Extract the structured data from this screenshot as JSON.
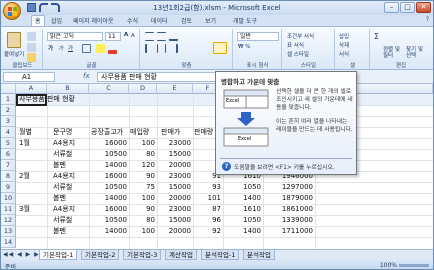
{
  "window": {
    "title": "13년1회2급(함).xlsm - Microsoft Excel",
    "controls": {
      "minimize": "–",
      "maximize": "□",
      "close": "✕"
    }
  },
  "ribbon": {
    "tabs": [
      "홈",
      "삽입",
      "페이지 레이아웃",
      "수식",
      "데이터",
      "검토",
      "보기",
      "개발 도구"
    ],
    "active_tab": "홈",
    "clipboard": {
      "paste_label": "붙여넣기",
      "group_label": "클립보드"
    },
    "font": {
      "name": "맑은 고딕",
      "size": "11",
      "group_label": "글꼴"
    },
    "alignment": {
      "group_label": "맞춤"
    },
    "number": {
      "format": "일반",
      "group_label": "표시 형식"
    },
    "styles": {
      "conditional": "조건부 서식",
      "table": "표 서식",
      "cell": "셀 스타일",
      "group_label": "스타일"
    },
    "cells": {
      "insert": "삽입",
      "delete": "삭제",
      "format": "서식",
      "group_label": "셀"
    },
    "editing": {
      "sort": "정렬 및 필터",
      "find": "찾기 및 선택",
      "group_label": "편집"
    }
  },
  "formula_bar": {
    "name_box": "A1",
    "fx": "fx",
    "formula": "사무용품 판매 현황"
  },
  "sheet": {
    "columns": [
      "A",
      "B",
      "C",
      "D",
      "E",
      "F",
      "G",
      "H"
    ],
    "rows": [
      "1",
      "2",
      "3",
      "4",
      "5",
      "6",
      "7",
      "8",
      "9",
      "10",
      "11",
      "12",
      "13",
      "14"
    ],
    "title_cell": "사무용품 판매 현황",
    "header_row": [
      "월별",
      "문구명",
      "공장출고가",
      "매입량",
      "판매가",
      "판매량",
      "",
      ""
    ],
    "data_rows": [
      [
        "1월",
        "A4용지",
        "16000",
        "100",
        "23000",
        "",
        "",
        ""
      ],
      [
        "",
        "서류철",
        "10500",
        "80",
        "15000",
        "",
        "",
        ""
      ],
      [
        "",
        "볼펜",
        "14000",
        "120",
        "20000",
        "",
        "",
        ""
      ],
      [
        "2월",
        "A4용지",
        "16000",
        "90",
        "23000",
        "91",
        "1610",
        "1946000"
      ],
      [
        "",
        "서류철",
        "10500",
        "75",
        "15000",
        "93",
        "1050",
        "1297000"
      ],
      [
        "",
        "볼펜",
        "14000",
        "100",
        "20000",
        "101",
        "1400",
        "1879000"
      ],
      [
        "3월",
        "A4용지",
        "16000",
        "90",
        "23000",
        "87",
        "1610",
        "1861000"
      ],
      [
        "",
        "서류철",
        "10500",
        "80",
        "15000",
        "96",
        "1050",
        "1339000"
      ],
      [
        "",
        "볼펜",
        "14000",
        "100",
        "20000",
        "92",
        "1400",
        "1711000"
      ]
    ]
  },
  "tooltip": {
    "title": "병합하고 가운데 맞춤",
    "body1": "선택한 셀을 더 큰 한 개의 셀로 조인시키고 새 셀의 가운데에 내용을 맞춥니다.",
    "body2": "이는 흔히 여러 열을 나타내는 레이블을 만드는 데 사용됩니다.",
    "image_label": "Excel",
    "help": "도움말을 보려면 <F1> 키를 누르십시오."
  },
  "sheet_tabs": {
    "nav": "◀◀ ◀ ▶ ▶▶",
    "tabs": [
      "기본작업-1",
      "기본작업-2",
      "기본작업-3",
      "계산작업",
      "분석작업-1",
      "분석작업"
    ],
    "active": "기본작업-1"
  },
  "status_bar": {
    "ready": "준비",
    "zoom": "100%"
  },
  "colors": {
    "accent": "#2b63c6",
    "ribbon": "#dbe8f7",
    "selection": "#1f1f1f"
  }
}
